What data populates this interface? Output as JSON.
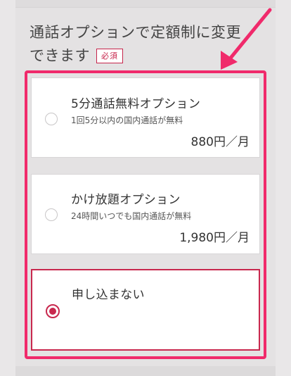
{
  "section": {
    "heading_line1": "通話オプションで定額制に変更",
    "heading_line2": "できます",
    "required_badge": "必須"
  },
  "options": [
    {
      "title": "5分通話無料オプション",
      "description": "1回5分以内の国内通話が無料",
      "price": "880円／月",
      "selected": false
    },
    {
      "title": "かけ放題オプション",
      "description": "24時間いつでも国内通話が無料",
      "price": "1,980円／月",
      "selected": false
    },
    {
      "title": "申し込まない",
      "selected": true
    }
  ],
  "colors": {
    "accent": "#c8284e",
    "highlight": "#f02a6b",
    "background": "#e4e2e3"
  },
  "icons": {
    "annotation": "arrow-icon",
    "radio_on": "radio-checked-icon",
    "radio_off": "radio-unchecked-icon"
  }
}
